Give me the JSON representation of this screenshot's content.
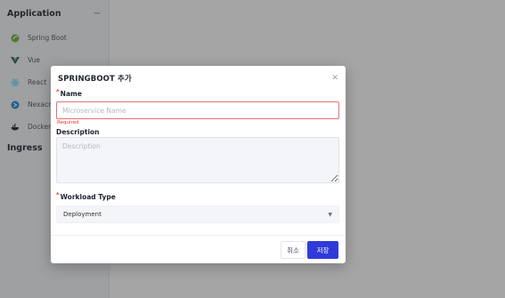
{
  "sidebar": {
    "application_title": "Application",
    "collapse_icon": "minus-icon",
    "items": [
      {
        "label": "Spring Boot",
        "icon": "spring-boot-icon"
      },
      {
        "label": "Vue",
        "icon": "vue-icon"
      },
      {
        "label": "React",
        "icon": "react-icon"
      },
      {
        "label": "Nexacro",
        "icon": "nexacro-icon"
      },
      {
        "label": "Docker",
        "icon": "docker-icon"
      }
    ],
    "ingress_title": "Ingress"
  },
  "dialog": {
    "title": "SPRINGBOOT 추가",
    "close_icon": "close-icon",
    "name_label": "Name",
    "required_mark": "*",
    "name_placeholder": "Microservice Name",
    "name_value": "",
    "name_error": "Required",
    "description_label": "Description",
    "description_placeholder": "Description",
    "description_value": "",
    "workload_label": "Workload Type",
    "workload_value": "Deployment",
    "cancel_label": "취소",
    "save_label": "저장"
  },
  "colors": {
    "primary": "#2f3ad9",
    "error": "#e53935",
    "spring": "#6db33f",
    "vue": "#35495e",
    "react": "#61dafb",
    "nexacro": "#1e88e5"
  }
}
